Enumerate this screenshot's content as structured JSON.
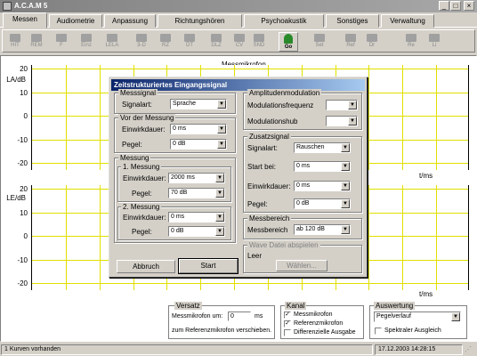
{
  "window": {
    "title": "A.C.A.M 5",
    "min": "_",
    "max": "□",
    "close": "×"
  },
  "tabs": [
    {
      "label": "Messen"
    },
    {
      "label": "Audiometrie"
    },
    {
      "label": "Anpassung"
    },
    {
      "label": "Richtungshören"
    },
    {
      "label": "Psychoakustik"
    },
    {
      "label": "Sonstiges"
    },
    {
      "label": "Verwaltung"
    }
  ],
  "toolbar": [
    "HIT",
    "REM",
    "F",
    "Einz",
    "LELA",
    "3-D",
    "RZ",
    "DT",
    "DLZ",
    "CV",
    "SND",
    "Go",
    "Set",
    "Ref",
    "Dr",
    "Re",
    "Li"
  ],
  "plot_top": {
    "ylabel": "LA/dB",
    "title": "Messmikrofon",
    "xunit": "t/ms",
    "ticks": [
      "20",
      "10",
      "0",
      "-10",
      "-20"
    ]
  },
  "plot_bottom": {
    "ylabel": "LE/dB",
    "xunit": "t/ms",
    "ticks": [
      "20",
      "10",
      "0",
      "-10",
      "-20"
    ]
  },
  "dialog": {
    "title": "Zeitstrukturiertes Eingangssignal",
    "messsignal": {
      "label": "Messsignal",
      "signalart_label": "Signalart:",
      "signalart": "Sprache"
    },
    "vor": {
      "label": "Vor der Messung",
      "einwirk_label": "Einwirkdauer:",
      "einwirk": "0 ms",
      "pegel_label": "Pegel:",
      "pegel": "0 dB"
    },
    "messung": {
      "label": "Messung",
      "m1": "1. Messung",
      "m1_einwirk_label": "Einwirkdauer:",
      "m1_einwirk": "2000 ms",
      "m1_pegel_label": "Pegel:",
      "m1_pegel": "70 dB",
      "m2": "2. Messung",
      "m2_einwirk_label": "Einwirkdauer:",
      "m2_einwirk": "0 ms",
      "m2_pegel_label": "Pegel:",
      "m2_pegel": "0 dB"
    },
    "amp": {
      "label": "Amplitudenmodulation",
      "freq_label": "Modulationsfrequenz",
      "hub_label": "Modulationshub"
    },
    "zusatz": {
      "label": "Zusatzsignal",
      "signalart_label": "Signalart:",
      "signalart": "Rauschen",
      "start_label": "Start bei:",
      "start": "0 ms",
      "einwirk_label": "Einwirkdauer:",
      "einwirk": "0 ms",
      "pegel_label": "Pegel:",
      "pegel": "0 dB"
    },
    "bereich": {
      "label": "Messbereich",
      "field_label": "Messbereich",
      "value": "ab 120 dB"
    },
    "wave": {
      "label": "Wave Datei abspielen",
      "value": "Leer",
      "button": "Wählen..."
    },
    "abbruch": "Abbruch",
    "start": "Start"
  },
  "versatz": {
    "label": "Versatz",
    "text1": "Messmikrofon um:",
    "value": "0",
    "unit": "ms",
    "text2": "zum Referenzmikrofon verschieben."
  },
  "kanal": {
    "label": "Kanal",
    "items": [
      {
        "label": "Messmikrofon",
        "checked": "✓"
      },
      {
        "label": "Referenzmikrofon",
        "checked": "✓"
      },
      {
        "label": "Differenzielle Ausgabe",
        "checked": ""
      }
    ]
  },
  "auswertung": {
    "label": "Auswertung",
    "value": "Pegelverlauf",
    "check_label": "Spektraler Ausgleich"
  },
  "status": {
    "left": "1 Kurven vorhanden",
    "datetime": "17.12.2003 14:28:15"
  }
}
